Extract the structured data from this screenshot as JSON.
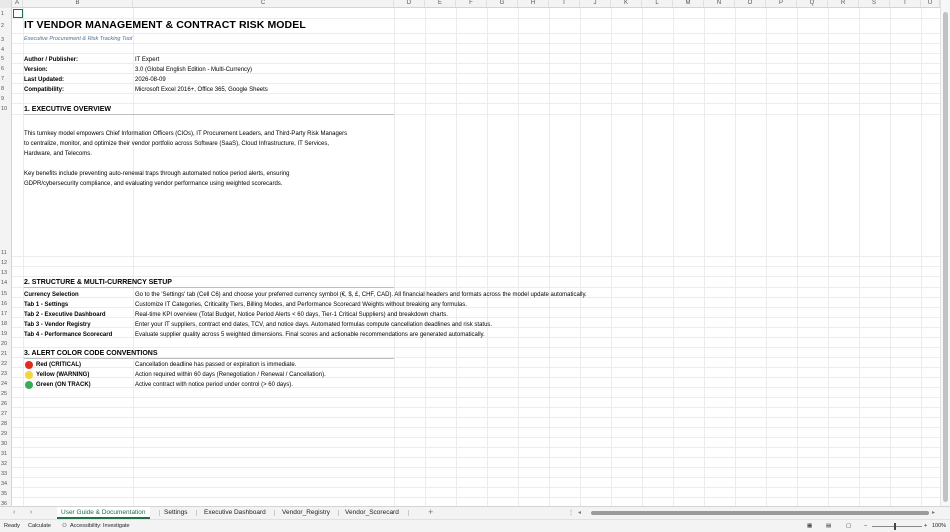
{
  "sheet": {
    "columns": [
      "A",
      "B",
      "C",
      "D",
      "E",
      "F",
      "G",
      "H",
      "I",
      "J",
      "K",
      "L",
      "M",
      "N",
      "O",
      "P",
      "Q",
      "R",
      "S",
      "T",
      "U"
    ],
    "rows": [
      "1",
      "2",
      "3",
      "4",
      "5",
      "6",
      "7",
      "8",
      "9",
      "10",
      "11",
      "12",
      "13",
      "14",
      "15",
      "16",
      "17",
      "18",
      "19",
      "20",
      "21",
      "22",
      "23",
      "24",
      "25",
      "26",
      "27",
      "28",
      "29",
      "30",
      "31",
      "32",
      "33",
      "34",
      "35",
      "36"
    ],
    "title": "IT VENDOR MANAGEMENT & CONTRACT RISK MODEL",
    "subtitle": "Executive Procurement & Risk Tracking Tool",
    "meta": [
      {
        "label": "Author / Publisher:",
        "value": "IT Expert"
      },
      {
        "label": "Version:",
        "value": "3.0 (Global English Edition - Multi-Currency)"
      },
      {
        "label": "Last Updated:",
        "value": "2026-08-09"
      },
      {
        "label": "Compatibility:",
        "value": "Microsoft Excel 2016+, Office 365, Google Sheets"
      }
    ],
    "section1": {
      "heading": "1. EXECUTIVE OVERVIEW",
      "lines": [
        "This turnkey model empowers Chief Information Officers (CIOs), IT Procurement Leaders, and Third-Party Risk Managers",
        "to centralize, monitor, and optimize their vendor portfolio across Software (SaaS), Cloud Infrastructure, IT Services,",
        "Hardware, and Telecoms.",
        "Key benefits include preventing auto-renewal traps through automated notice period alerts, ensuring",
        "GDPR/cybersecurity compliance, and evaluating vendor performance using weighted scorecards."
      ]
    },
    "section2": {
      "heading": "2. STRUCTURE & MULTI-CURRENCY SETUP",
      "items": [
        {
          "label": "Currency Selection",
          "value": "Go to the 'Settings' tab (Cell C6) and choose your preferred currency symbol (€, $, £, CHF, CAD). All financial headers and formats across the model update automatically."
        },
        {
          "label": "Tab 1 - Settings",
          "value": "Customize IT Categories, Criticality Tiers, Billing Modes, and Performance Scorecard Weights without breaking any formulas."
        },
        {
          "label": "Tab 2 - Executive Dashboard",
          "value": "Real-time KPI overview (Total Budget, Notice Period Alerts < 60 days, Tier-1 Critical Suppliers) and breakdown charts."
        },
        {
          "label": "Tab 3 - Vendor Registry",
          "value": "Enter your IT suppliers, contract end dates, TCV, and notice days. Automated formulas compute cancellation deadlines and risk status."
        },
        {
          "label": "Tab 4 - Performance Scorecard",
          "value": "Evaluate supplier quality across 5 weighted dimensions. Final scores and actionable recommendations are generated automatically."
        }
      ]
    },
    "section3": {
      "heading": "3. ALERT COLOR CODE CONVENTIONS",
      "items": [
        {
          "label": "Red (CRITICAL)",
          "value": "Cancellation deadline has passed or expiration is immediate.",
          "color": "#e02b20"
        },
        {
          "label": "Yellow (WARNING)",
          "value": "Action required within 60 days (Renegotiation / Renewal / Cancellation).",
          "color": "#f5d33b"
        },
        {
          "label": "Green (ON TRACK)",
          "value": "Active contract with notice period under control (> 60 days).",
          "color": "#3aaa5c"
        }
      ]
    }
  },
  "tabs": [
    {
      "label": "User Guide & Documentation",
      "active": true
    },
    {
      "label": "Settings",
      "active": false
    },
    {
      "label": "Executive Dashboard",
      "active": false
    },
    {
      "label": "Vendor_Registry",
      "active": false
    },
    {
      "label": "Vendor_Scorecard",
      "active": false
    }
  ],
  "add_tab": "+",
  "status": {
    "ready": "Ready",
    "calculate": "Calculate",
    "accessibility": "Accessibility: Investigate",
    "zoom": "100%"
  },
  "colors": {
    "accent": "#1e7145"
  }
}
